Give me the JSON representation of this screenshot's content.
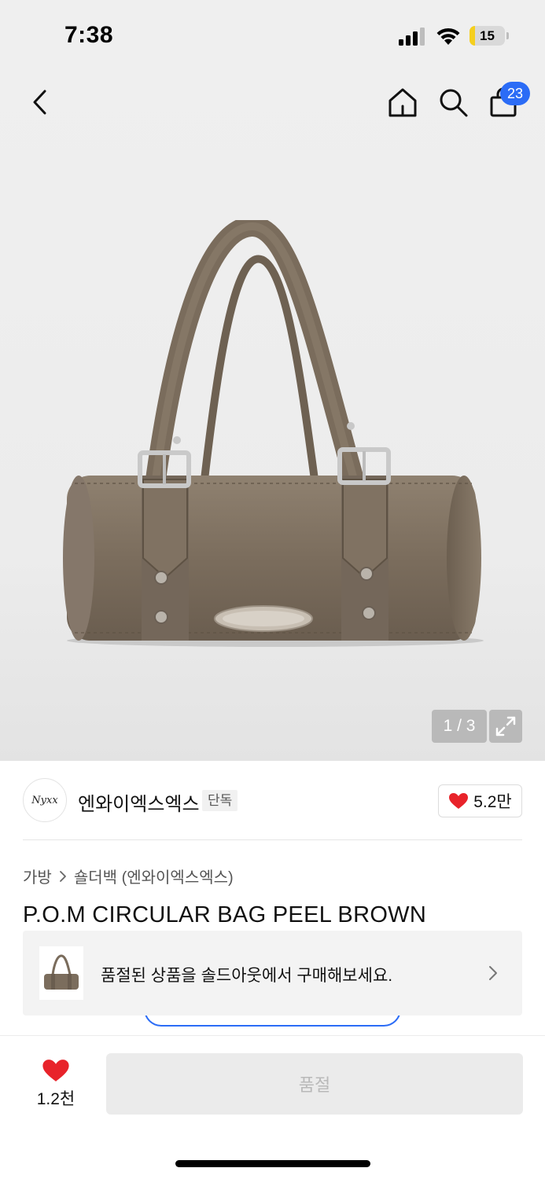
{
  "status_bar": {
    "time": "7:38",
    "battery_level": "15",
    "battery_color": "#f5cf1e",
    "icons": [
      "signal-icon",
      "wifi-icon",
      "battery-charging-icon"
    ]
  },
  "header": {
    "icons": [
      "back-chevron-icon",
      "home-icon",
      "search-icon",
      "shopping-bag-icon"
    ],
    "cart_count": "23",
    "badge_color": "#2b6cf6"
  },
  "gallery": {
    "counter": "1 / 3",
    "current_index": 1,
    "total": 3
  },
  "brand": {
    "logo_text": "Nyxx",
    "name": "엔와이엑스엑스",
    "badge": "단독",
    "like_count": "5.2만"
  },
  "breadcrumb": {
    "category": "가방",
    "subcategory": "숄더백 (엔와이엑스엑스)"
  },
  "product": {
    "title": "P.O.M CIRCULAR BAG PEEL BROWN"
  },
  "soldout_banner": {
    "text": "품절된 상품을 솔드아웃에서 구매해보세요."
  },
  "bottom_bar": {
    "wish_count": "1.2천",
    "action_label": "품절",
    "heart_color": "#e8232a"
  }
}
